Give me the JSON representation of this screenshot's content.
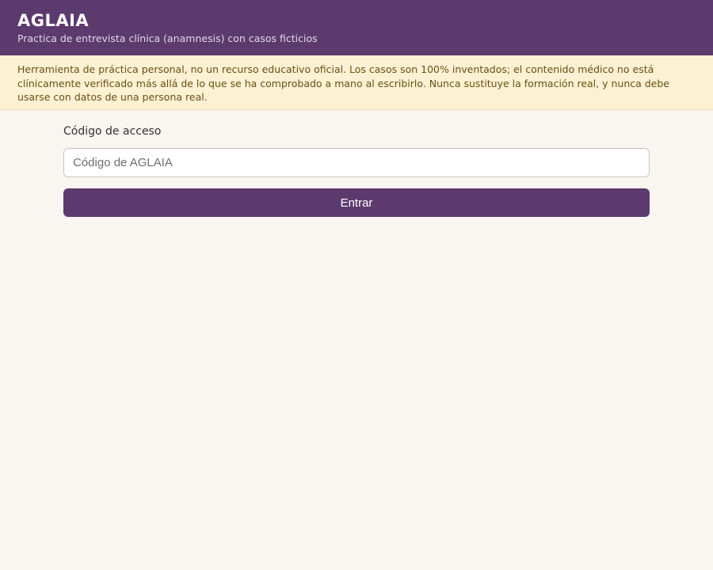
{
  "header": {
    "title": "AGLAIA",
    "subtitle": "Practica de entrevista clínica (anamnesis) con casos ficticios"
  },
  "disclaimer": {
    "text": "Herramienta de práctica personal, no un recurso educativo oficial. Los casos son 100% inventados; el contenido médico no está clínicamente verificado más allá de lo que se ha comprobado a mano al escribirlo. Nunca sustituye la formación real, y nunca debe usarse con datos de una persona real."
  },
  "login": {
    "label": "Código de acceso",
    "placeholder": "Código de AGLAIA",
    "value": "",
    "submit_label": "Entrar"
  },
  "colors": {
    "brand": "#5c3a6e",
    "background": "#f9f5f1",
    "warning_bg": "#fdf1d4",
    "warning_text": "#6a4f10"
  }
}
